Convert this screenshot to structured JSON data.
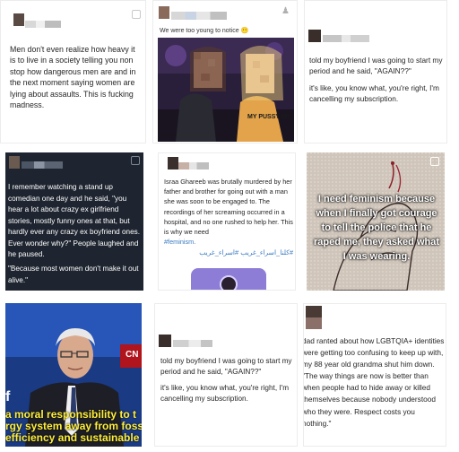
{
  "grid": {
    "posts": [
      {
        "text": "Men don't even realize how heavy it is to live in a society telling you non stop how dangerous men are and in the next moment saying women are lying about assaults. This is fucking madness."
      },
      {
        "caption": "We were too young to notice 😶",
        "shirt_text": "MY PUSSY MY"
      },
      {
        "line1": "told my boyfriend I was going to start my period and he said, \"AGAIN??\"",
        "line2": "it's like, you know what, you're right, I'm cancelling my subscription."
      },
      {
        "line1": "I remember watching a stand up comedian one day and he said, \"you hear  a lot about crazy ex girlfriend stories, mostly funny ones at that, but hardly ever any crazy ex boyfriend ones. Ever wonder why?\" People laughed and he paused.",
        "line2": "\"Because most women don't make it out alive.\""
      },
      {
        "text": "Israa Ghareeb was brutally murdered by her father and brother for going out with a man she was soon to be engaged to. The recordings of her screaming occurred in a hospital, and no one rushed to help her. This is why we need",
        "hashtag1": "#feminism.",
        "hashtag2": "#كلنا_اسراء_غريب #اسراء_غريب"
      },
      {
        "overlay": "I need feminism because when I finally got courage to tell the police that he raped me, they asked what I was wearing."
      },
      {
        "subtitle1": "a moral responsibility to t",
        "subtitle2": "rgy system away from foss",
        "subtitle3": "efficiency and sustainable",
        "logo_left": "f",
        "logo_right": "CN"
      },
      {
        "line1": "told my boyfriend I was going to start my period and he said, \"AGAIN??\"",
        "line2": "it's like, you know what, you're right, I'm cancelling my subscription."
      },
      {
        "text": "dad ranted about how LGBTQIA+ identities were getting too confusing to keep up with, my 88 year old grandma shut him down. \"The way things are now is better than when people had to hide away or killed themselves because nobody understood who they were. Respect costs you nothing.\""
      }
    ]
  },
  "colors": {
    "accent_purple": "#8e7dd6",
    "hashtag_blue": "#3b7bc2",
    "dark_tile": "#1e2530",
    "cnn_red": "#b0141c"
  }
}
